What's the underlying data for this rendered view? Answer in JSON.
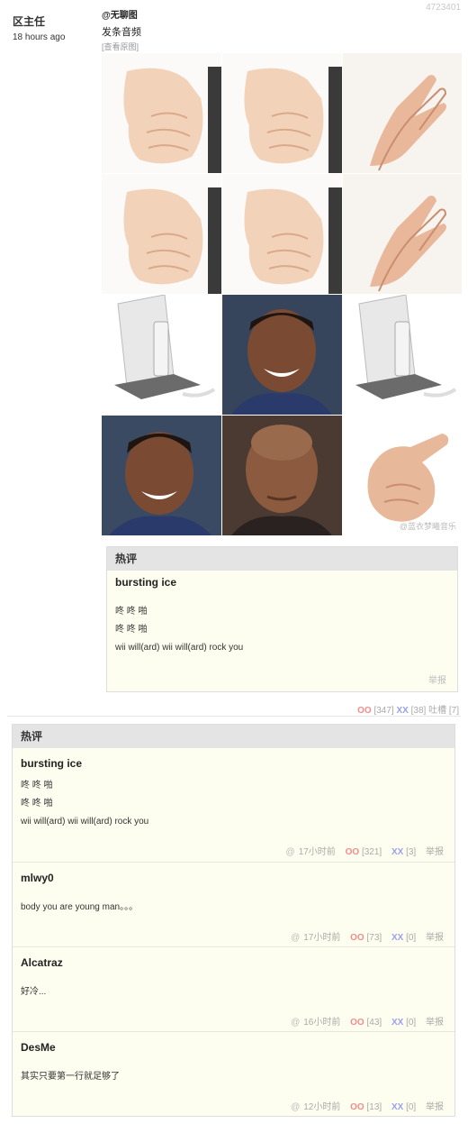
{
  "post": {
    "id": "4723401",
    "author": "区主任",
    "time": "18 hours ago",
    "mention": "@无聊图",
    "text": "发条音频",
    "view_original": "[查看原图]",
    "watermark": "@蓝衣梦曦音乐",
    "oo_label": "OO",
    "oo_count": "[347]",
    "xx_label": "XX",
    "xx_count": "[38]",
    "tucao_label": "吐槽",
    "tucao_count": "[7]"
  },
  "hot_inline": {
    "title": "热评",
    "user": "bursting ice",
    "lines": [
      "咚 咚 啪",
      "咚 咚 啪",
      "wii will(ard) wii will(ard) rock you"
    ],
    "report": "举报"
  },
  "hot_section": {
    "title": "热评",
    "comments": [
      {
        "user": "bursting ice",
        "lines": [
          "咚 咚 啪",
          "咚 咚 啪",
          "wii will(ard) wii will(ard) rock you"
        ],
        "at": "@",
        "time": "17小时前",
        "oo_label": "OO",
        "oo": "[321]",
        "xx_label": "XX",
        "xx": "[3]",
        "report": "举报"
      },
      {
        "user": "mlwy0",
        "lines": [
          "body you are young man。。。"
        ],
        "at": "@",
        "time": "17小时前",
        "oo_label": "OO",
        "oo": "[73]",
        "xx_label": "XX",
        "xx": "[0]",
        "report": "举报"
      },
      {
        "user": "Alcatraz",
        "lines": [
          "好冷..."
        ],
        "at": "@",
        "time": "16小时前",
        "oo_label": "OO",
        "oo": "[43]",
        "xx_label": "XX",
        "xx": "[0]",
        "report": "举报"
      },
      {
        "user": "DesMe",
        "lines": [
          "其实只要第一行就足够了"
        ],
        "at": "@",
        "time": "12小时前",
        "oo_label": "OO",
        "oo": "[13]",
        "xx_label": "XX",
        "xx": "[0]",
        "report": "举报"
      }
    ]
  },
  "images": [
    "fist-image",
    "fist-image",
    "clap-image",
    "fist-image",
    "fist-image",
    "clap-image",
    "wii-console-image",
    "will-smith-image",
    "wii-console-image",
    "will-smith-image",
    "dwayne-johnson-image",
    "pointing-finger-image"
  ],
  "colors": {
    "oo": "#f28b8b",
    "xx": "#9a9ff0",
    "hot_bg": "#fefef0",
    "hot_title_bg": "#e4e4e4"
  }
}
